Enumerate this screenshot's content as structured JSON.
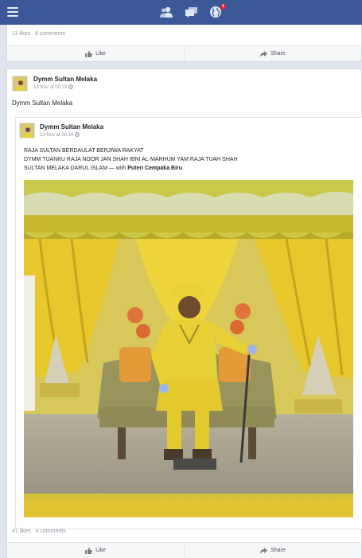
{
  "topbar": {
    "menu_icon": "menu-icon",
    "icons": [
      "friends-icon",
      "messages-icon",
      "globe-notifications-icon"
    ],
    "notification_badge": "1",
    "colors": {
      "bar": "#3b5998",
      "icon": "#dfe5f2",
      "badge": "#e0262d"
    }
  },
  "prev_post": {
    "likes": "11 likes",
    "comments": "8 comments",
    "like_label": "Like",
    "share_label": "Share"
  },
  "post": {
    "author": "Dymm Sultan Melaka",
    "timestamp": "13 Nov at 00:23",
    "text": "Dymm Sultan Melaka",
    "shared": {
      "author": "Dymm Sultan Melaka",
      "timestamp": "13 Nov at 00:19",
      "line1": "RAJA SULTAN BERDAULAT BERJIWA RAKYAT",
      "line2": "DYMM TUANKU RAJA NOOR JAN SHAH IBNI AL-MARHUM YAM RAJA TUAH SHAH",
      "line3_prefix": "SULTAN MELAKA DARUL ISLAM — with ",
      "line3_tag": "Puteri Cempaka Biru",
      "line3_suffix": "."
    },
    "likes": "41 likes",
    "comments": "4 comments",
    "like_label": "Like",
    "share_label": "Share"
  }
}
